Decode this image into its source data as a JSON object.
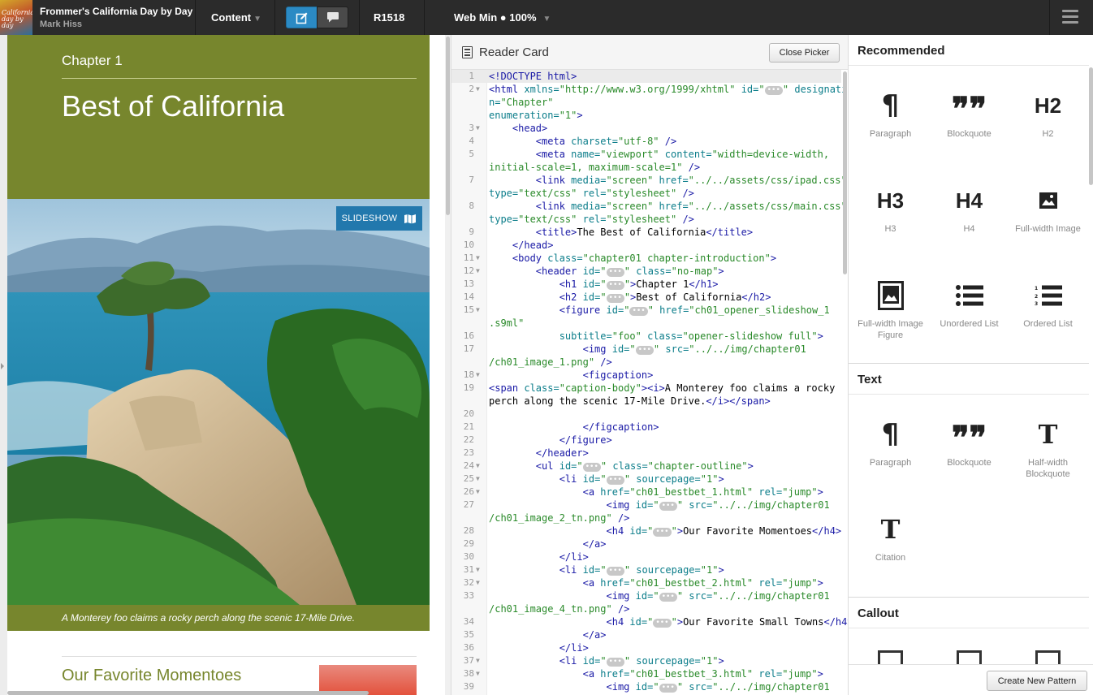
{
  "app": {
    "book_title": "Frommer's California Day by Day",
    "author": "Mark Hiss",
    "cover_text": "California day by day",
    "content_menu": "Content",
    "revision": "R1518",
    "view_mode": "Web Min ● 100%"
  },
  "preview": {
    "chapter_label": "Chapter 1",
    "title": "Best of California",
    "slideshow_label": "SLIDESHOW",
    "caption": "A Monterey foo claims a rocky perch along the scenic 17-Mile Drive.",
    "section_title": "Our Favorite Momentoes"
  },
  "code_pane": {
    "title": "Reader Card",
    "close_label": "Close Picker",
    "current_line": 1
  },
  "panel": {
    "recommended": {
      "title": "Recommended",
      "items": [
        {
          "label": "Paragraph",
          "icon": "pilcrow-icon",
          "glyph": "¶"
        },
        {
          "label": "Blockquote",
          "icon": "blockquote-icon",
          "glyph": "❞"
        },
        {
          "label": "H2",
          "icon": "h2-icon",
          "glyph": "H2"
        },
        {
          "label": "H3",
          "icon": "h3-icon",
          "glyph": "H3"
        },
        {
          "label": "H4",
          "icon": "h4-icon",
          "glyph": "H4"
        },
        {
          "label": "Full-width Image",
          "icon": "image-icon",
          "glyph": ""
        },
        {
          "label": "Full-width Image Figure",
          "icon": "image-figure-icon",
          "glyph": ""
        },
        {
          "label": "Unordered List",
          "icon": "unordered-list-icon",
          "glyph": ""
        },
        {
          "label": "Ordered List",
          "icon": "ordered-list-icon",
          "glyph": ""
        }
      ]
    },
    "text": {
      "title": "Text",
      "items": [
        {
          "label": "Paragraph",
          "icon": "pilcrow-icon",
          "glyph": "¶"
        },
        {
          "label": "Blockquote",
          "icon": "blockquote-icon",
          "glyph": "❞"
        },
        {
          "label": "Half-width Blockquote",
          "icon": "serif-t-icon",
          "glyph": "T"
        },
        {
          "label": "Citation",
          "icon": "serif-t-icon",
          "glyph": "T"
        }
      ]
    },
    "callout": {
      "title": "Callout"
    },
    "create_label": "Create New Pattern"
  },
  "colors": {
    "olive": "#77862d",
    "accent_blue": "#2278ad",
    "topbar": "#2b2b2b"
  }
}
